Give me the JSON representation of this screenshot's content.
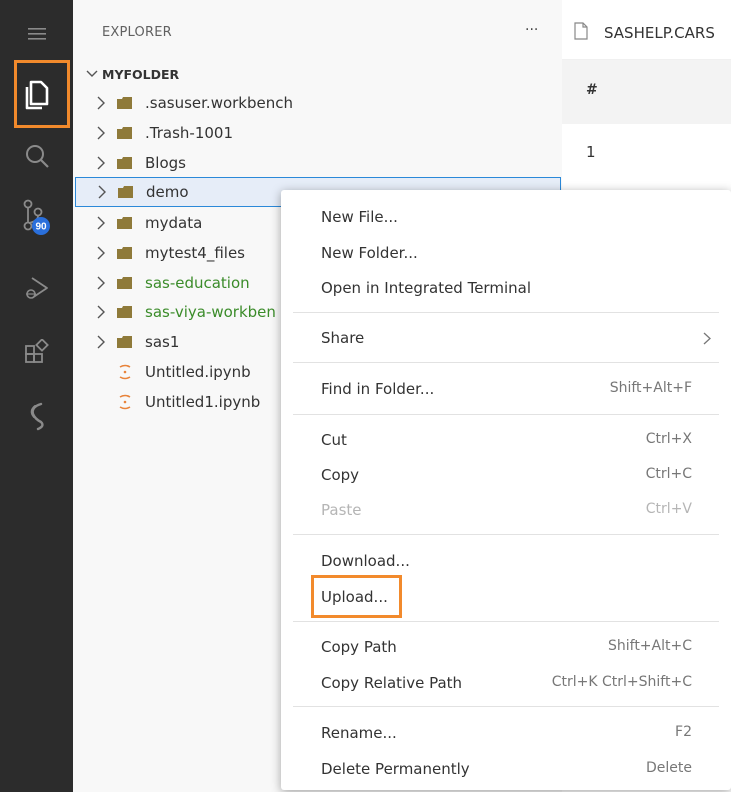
{
  "activity_bar": {
    "source_control_badge": "90",
    "highlight_color": "#f28a2c"
  },
  "explorer": {
    "title": "EXPLORER",
    "more_label": "···",
    "root_folder": "MYFOLDER",
    "folders": [
      {
        "label": ".sasuser.workbench"
      },
      {
        "label": ".Trash-1001"
      },
      {
        "label": "Blogs"
      },
      {
        "label": "demo"
      },
      {
        "label": "mydata"
      },
      {
        "label": "mytest4_files"
      },
      {
        "label": "sas-education"
      },
      {
        "label": "sas-viya-workben"
      },
      {
        "label": "sas1"
      }
    ],
    "files": [
      {
        "label": "Untitled.ipynb"
      },
      {
        "label": "Untitled1.ipynb"
      }
    ]
  },
  "editor": {
    "tab_title": "SASHELP.CARS",
    "grid_header": "#",
    "grid_first_cell": "1"
  },
  "context_menu": {
    "new_file": "New File...",
    "new_folder": "New Folder...",
    "open_terminal": "Open in Integrated Terminal",
    "share": "Share",
    "find_in_folder": "Find in Folder...",
    "find_in_folder_shortcut": "Shift+Alt+F",
    "cut": "Cut",
    "cut_shortcut": "Ctrl+X",
    "copy": "Copy",
    "copy_shortcut": "Ctrl+C",
    "paste": "Paste",
    "paste_shortcut": "Ctrl+V",
    "download": "Download...",
    "upload": "Upload...",
    "copy_path": "Copy Path",
    "copy_path_shortcut": "Shift+Alt+C",
    "copy_relative_path": "Copy Relative Path",
    "copy_relative_path_shortcut": "Ctrl+K Ctrl+Shift+C",
    "rename": "Rename...",
    "rename_shortcut": "F2",
    "delete": "Delete Permanently",
    "delete_shortcut": "Delete"
  }
}
